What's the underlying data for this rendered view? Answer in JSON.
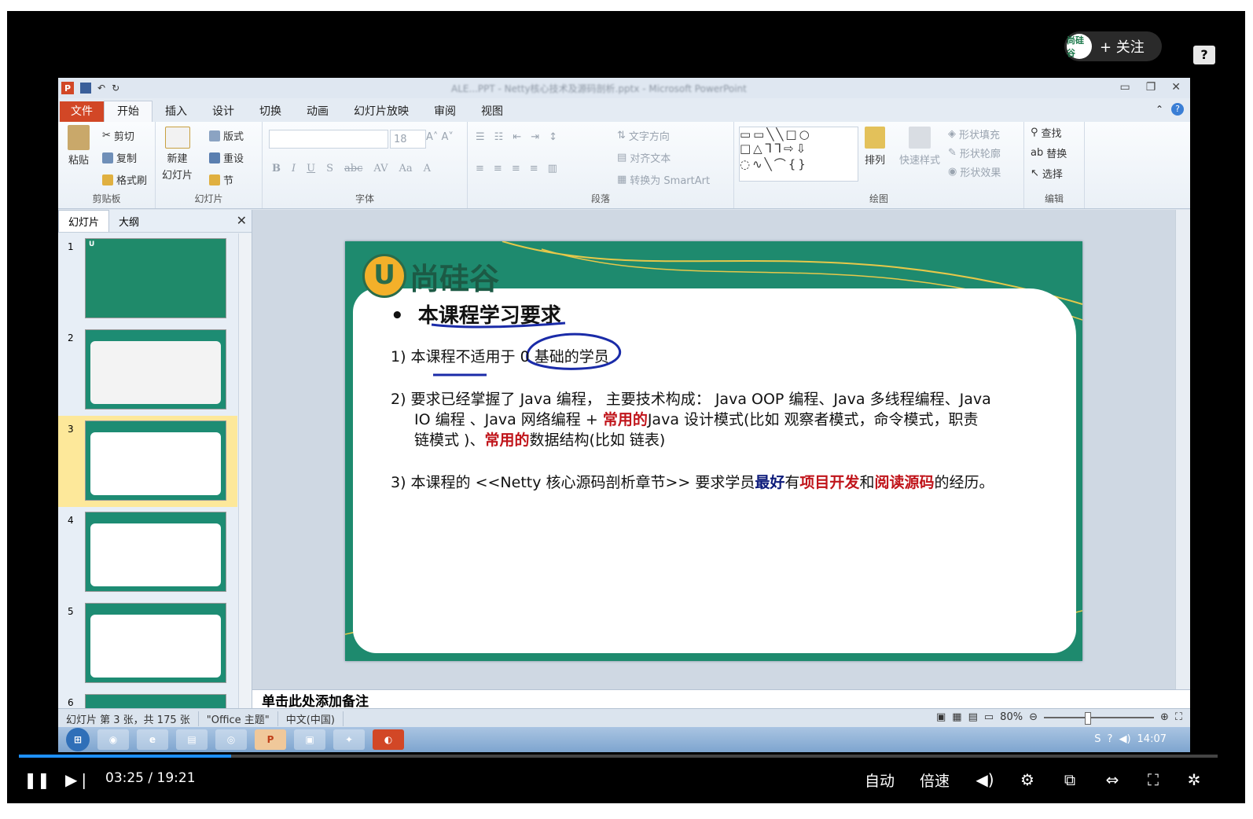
{
  "player": {
    "follow_label": "+ 关注",
    "follow_avatar_text": "尚硅谷",
    "help_label": "?",
    "time_current": "03:25",
    "time_separator": "/",
    "time_total": "19:21",
    "progress_fraction": 0.177,
    "right_controls": {
      "auto_label": "自动",
      "speed_label": "倍速"
    },
    "icons": [
      "pause-icon",
      "next-icon",
      "volume-icon",
      "settings-icon",
      "pip-icon",
      "widescreen-icon",
      "fullscreen-icon",
      "snapshot-icon"
    ]
  },
  "ppt": {
    "app_letter": "P",
    "window_title": "ALE...PPT - Netty核心技术及源码剖析.pptx - Microsoft PowerPoint",
    "tabs": [
      {
        "label": "文件"
      },
      {
        "label": "开始"
      },
      {
        "label": "插入"
      },
      {
        "label": "设计"
      },
      {
        "label": "切换"
      },
      {
        "label": "动画"
      },
      {
        "label": "幻灯片放映"
      },
      {
        "label": "审阅"
      },
      {
        "label": "视图"
      }
    ],
    "ribbon": {
      "clipboard": {
        "paste": "粘贴",
        "cut": "剪切",
        "copy": "复制",
        "format_painter": "格式刷",
        "group": "剪贴板"
      },
      "slides": {
        "new_slide": "新建",
        "new_slide2": "幻灯片",
        "layout": "版式",
        "reset": "重设",
        "section": "节",
        "group": "幻灯片"
      },
      "font": {
        "size": "18",
        "group": "字体"
      },
      "paragraph": {
        "text_direction": "文字方向",
        "align_text": "对齐文本",
        "smartart": "转换为 SmartArt",
        "group": "段落"
      },
      "drawing": {
        "arrange": "排列",
        "quick_styles": "快速样式",
        "shape_fill": "形状填充",
        "shape_outline": "形状轮廓",
        "shape_effects": "形状效果",
        "group": "绘图"
      },
      "editing": {
        "find": "查找",
        "replace": "替换",
        "select": "选择",
        "group": "编辑"
      }
    },
    "left_pane": {
      "tab_slides": "幻灯片",
      "tab_outline": "大纲",
      "close": "✕",
      "thumb_numbers": [
        "1",
        "2",
        "3",
        "4",
        "5",
        "6"
      ]
    },
    "slide": {
      "logo_letter": "U",
      "logo_name": "尚硅谷",
      "bullet": "•",
      "title": "本课程学习要求",
      "line1": "1)  本课程不适用于 0 基础的学员",
      "line2a": "2)  要求已经掌握了 Java 编程，  主要技术构成：  Java OOP 编程、Java 多线程编程、Java",
      "line2b_pre": "IO 编程 、Java 网络编程 + ",
      "line2b_red": "常用的",
      "line2b_post": "Java 设计模式(比如 观察者模式，命令模式，职责",
      "line2c_pre": "链模式 )、",
      "line2c_red": "常用的",
      "line2c_post": "数据结构(比如 链表)",
      "line3_pre": "3)  本课程的 <<Netty 核心源码剖析章节>> 要求学员",
      "line3_navy": "最好",
      "line3_mid": "有",
      "line3_red1": "项目开发",
      "line3_and": "和",
      "line3_red2": "阅读源码",
      "line3_post": "的经历。"
    },
    "notes_placeholder": "单击此处添加备注",
    "status": {
      "slide_info": "幻灯片 第 3 张，共 175 张",
      "theme": "\"Office 主题\"",
      "language": "中文(中国)",
      "zoom": "80%"
    },
    "taskbar": {
      "clock": "14:07"
    }
  },
  "colors": {
    "accent_red": "#c0141a",
    "navy": "#0d1b7a",
    "slide_green": "#1e8a6e",
    "progress": "#1e90ff",
    "ppt_orange": "#d24726"
  }
}
